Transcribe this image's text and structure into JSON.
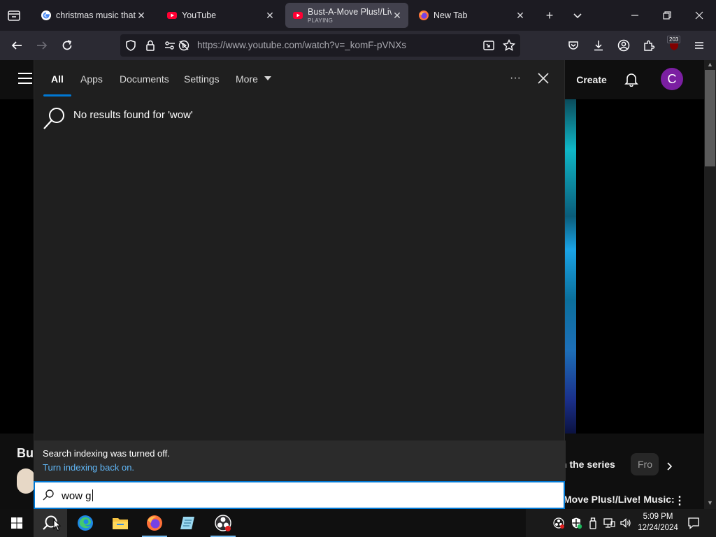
{
  "browser": {
    "tabs": [
      {
        "title": "christmas music that is",
        "subtitle": "",
        "favicon": "google-icon",
        "active": false
      },
      {
        "title": "YouTube",
        "subtitle": "",
        "favicon": "youtube-icon",
        "active": false
      },
      {
        "title": "Bust-A-Move Plus!/Liv",
        "subtitle": "PLAYING",
        "favicon": "youtube-icon",
        "active": true
      },
      {
        "title": "New Tab",
        "subtitle": "",
        "favicon": "firefox-icon",
        "active": false
      }
    ],
    "url": "https://www.youtube.com/watch?v=_komF-pVNXs",
    "extension_badge": "203"
  },
  "youtube": {
    "create_label": "Create",
    "avatar_letter": "C",
    "title_fragment": "Bu",
    "series_chip": "n the series",
    "from_chip": "Fro",
    "next_video_title": "Move Plus!/Live! Music:"
  },
  "search": {
    "tabs": [
      {
        "label": "All",
        "active": true
      },
      {
        "label": "Apps",
        "active": false
      },
      {
        "label": "Documents",
        "active": false
      },
      {
        "label": "Settings",
        "active": false
      },
      {
        "label": "More",
        "active": false
      }
    ],
    "no_results_text": "No results found for 'wow'",
    "indexing_text": "Search indexing was turned off.",
    "indexing_link": "Turn indexing back on.",
    "query": "wow g"
  },
  "taskbar": {
    "time": "5:09 PM",
    "date": "12/24/2024"
  },
  "colors": {
    "accent": "#0078d4",
    "link": "#60b6f5",
    "youtube_red": "#ff0033",
    "avatar_purple": "#7b1fa2"
  }
}
